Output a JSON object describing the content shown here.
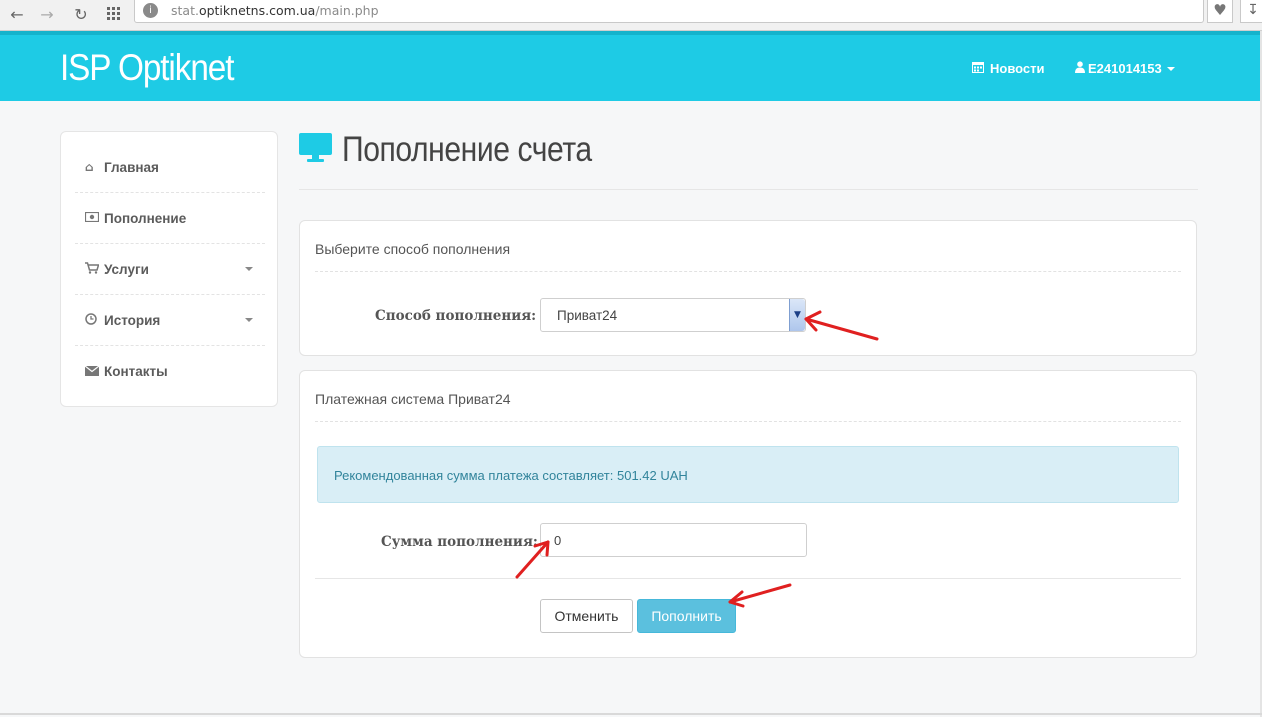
{
  "browser": {
    "url_prefix": "stat.",
    "url_domain": "optiknetns.com.ua",
    "url_path": "/main.php",
    "back_icon": "arrow-left-icon",
    "forward_icon": "arrow-right-icon",
    "reload_icon": "reload-icon",
    "apps_icon": "grid-icon",
    "heart_icon": "heart-icon",
    "download_icon": "download-icon"
  },
  "header": {
    "brand": "ISP Optiknet",
    "news_label": "Новости",
    "user_label": "E241014153",
    "bg_color": "#1ecbe5"
  },
  "sidebar": {
    "items": [
      {
        "label": "Главная",
        "icon": "home-icon"
      },
      {
        "label": "Пополнение",
        "icon": "money-icon"
      },
      {
        "label": "Услуги",
        "icon": "cart-icon",
        "has_dropdown": true
      },
      {
        "label": "История",
        "icon": "clock-icon",
        "has_dropdown": true
      },
      {
        "label": "Контакты",
        "icon": "envelope-icon"
      }
    ]
  },
  "page": {
    "title": "Пополнение счета",
    "icon": "monitor-icon"
  },
  "method_panel": {
    "heading": "Выберите способ пополнения",
    "label": "Способ пополнения:",
    "selected": "Приват24"
  },
  "payment_panel": {
    "heading": "Платежная система Приват24",
    "alert": "Рекомендованная сумма платежа составляет: 501.42 UAH",
    "amount_label": "Сумма пополнения:",
    "amount_value": "0",
    "cancel_label": "Отменить",
    "submit_label": "Пополнить"
  },
  "annotation_color": "#e02020"
}
